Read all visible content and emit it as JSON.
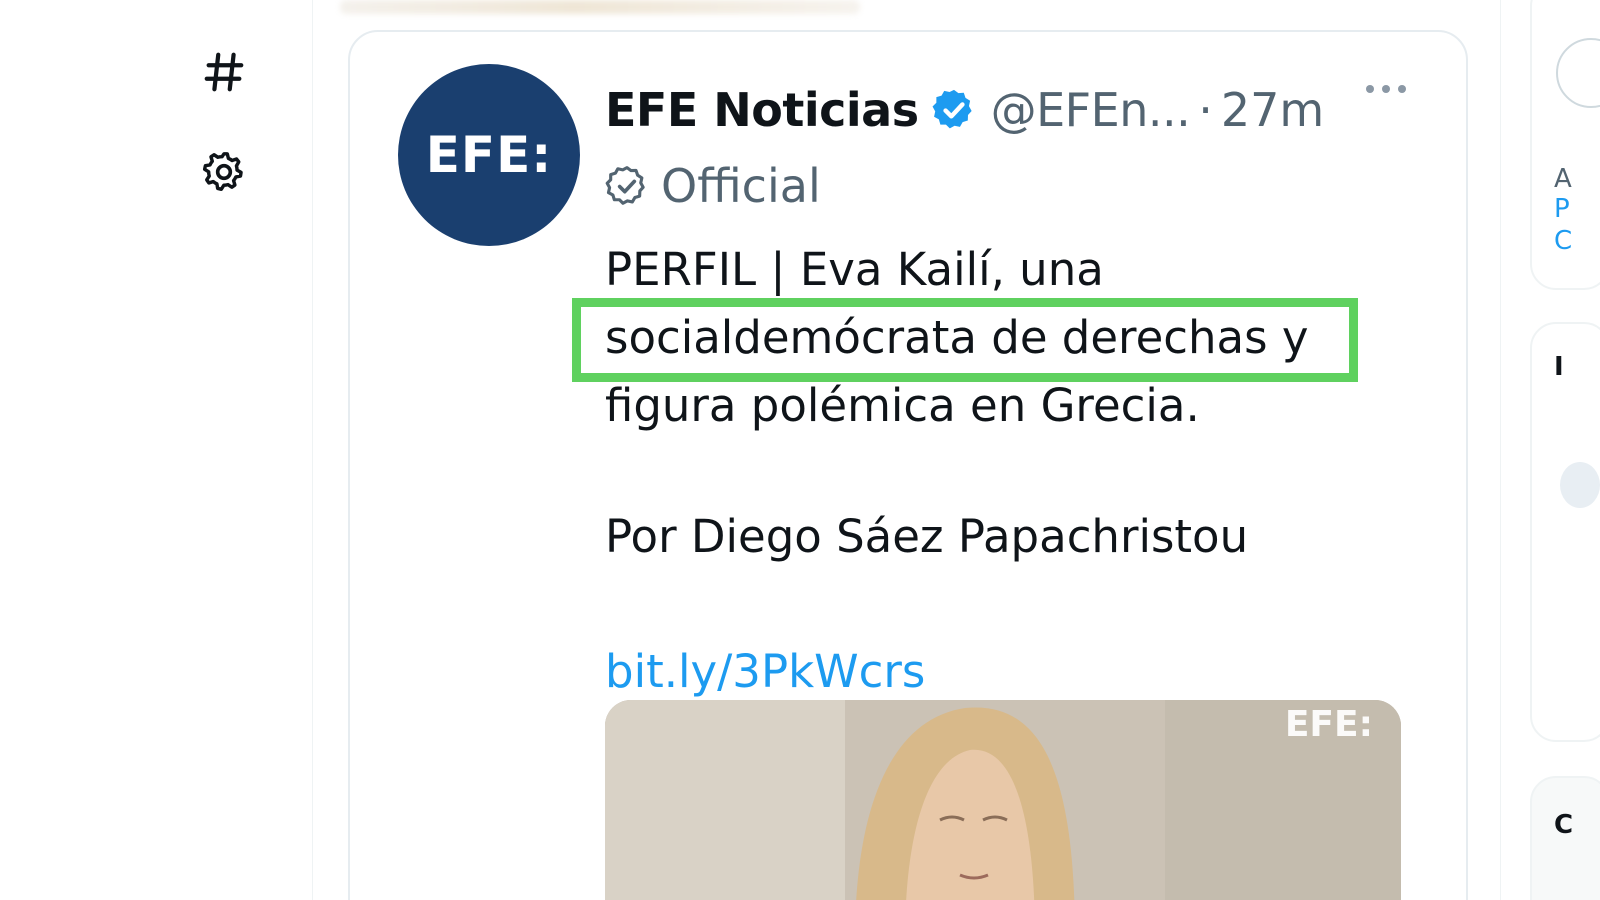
{
  "left_nav": {
    "explore_icon": "hashtag-icon",
    "settings_icon": "gear-icon"
  },
  "tweet": {
    "avatar_text": "EFE:",
    "author_name": "EFE Noticias",
    "verified_icon": "verified-badge-icon",
    "handle": "@EFEn...",
    "separator": "·",
    "timestamp": "27m",
    "more_icon": "more-options-icon",
    "official_icon": "official-check-icon",
    "official_label": "Official",
    "text_lines": [
      "PERFIL | Eva Kailí, una",
      "socialdemócrata de derechas y",
      "figura polémica en Grecia."
    ],
    "byline": "Por Diego Sáez Papachristou",
    "link": "bit.ly/3PkWcrs",
    "media_watermark": "EFE:"
  },
  "annotation": {
    "highlight_color": "#5fd15f"
  },
  "right_rail": {
    "text_1": "A",
    "text_2": "P",
    "text_3": "C",
    "text_4": "I",
    "text_5": "C"
  },
  "colors": {
    "avatar_bg": "#1a3f6f",
    "link": "#1d9bf0",
    "secondary_text": "#536471",
    "primary_text": "#0f1419"
  }
}
